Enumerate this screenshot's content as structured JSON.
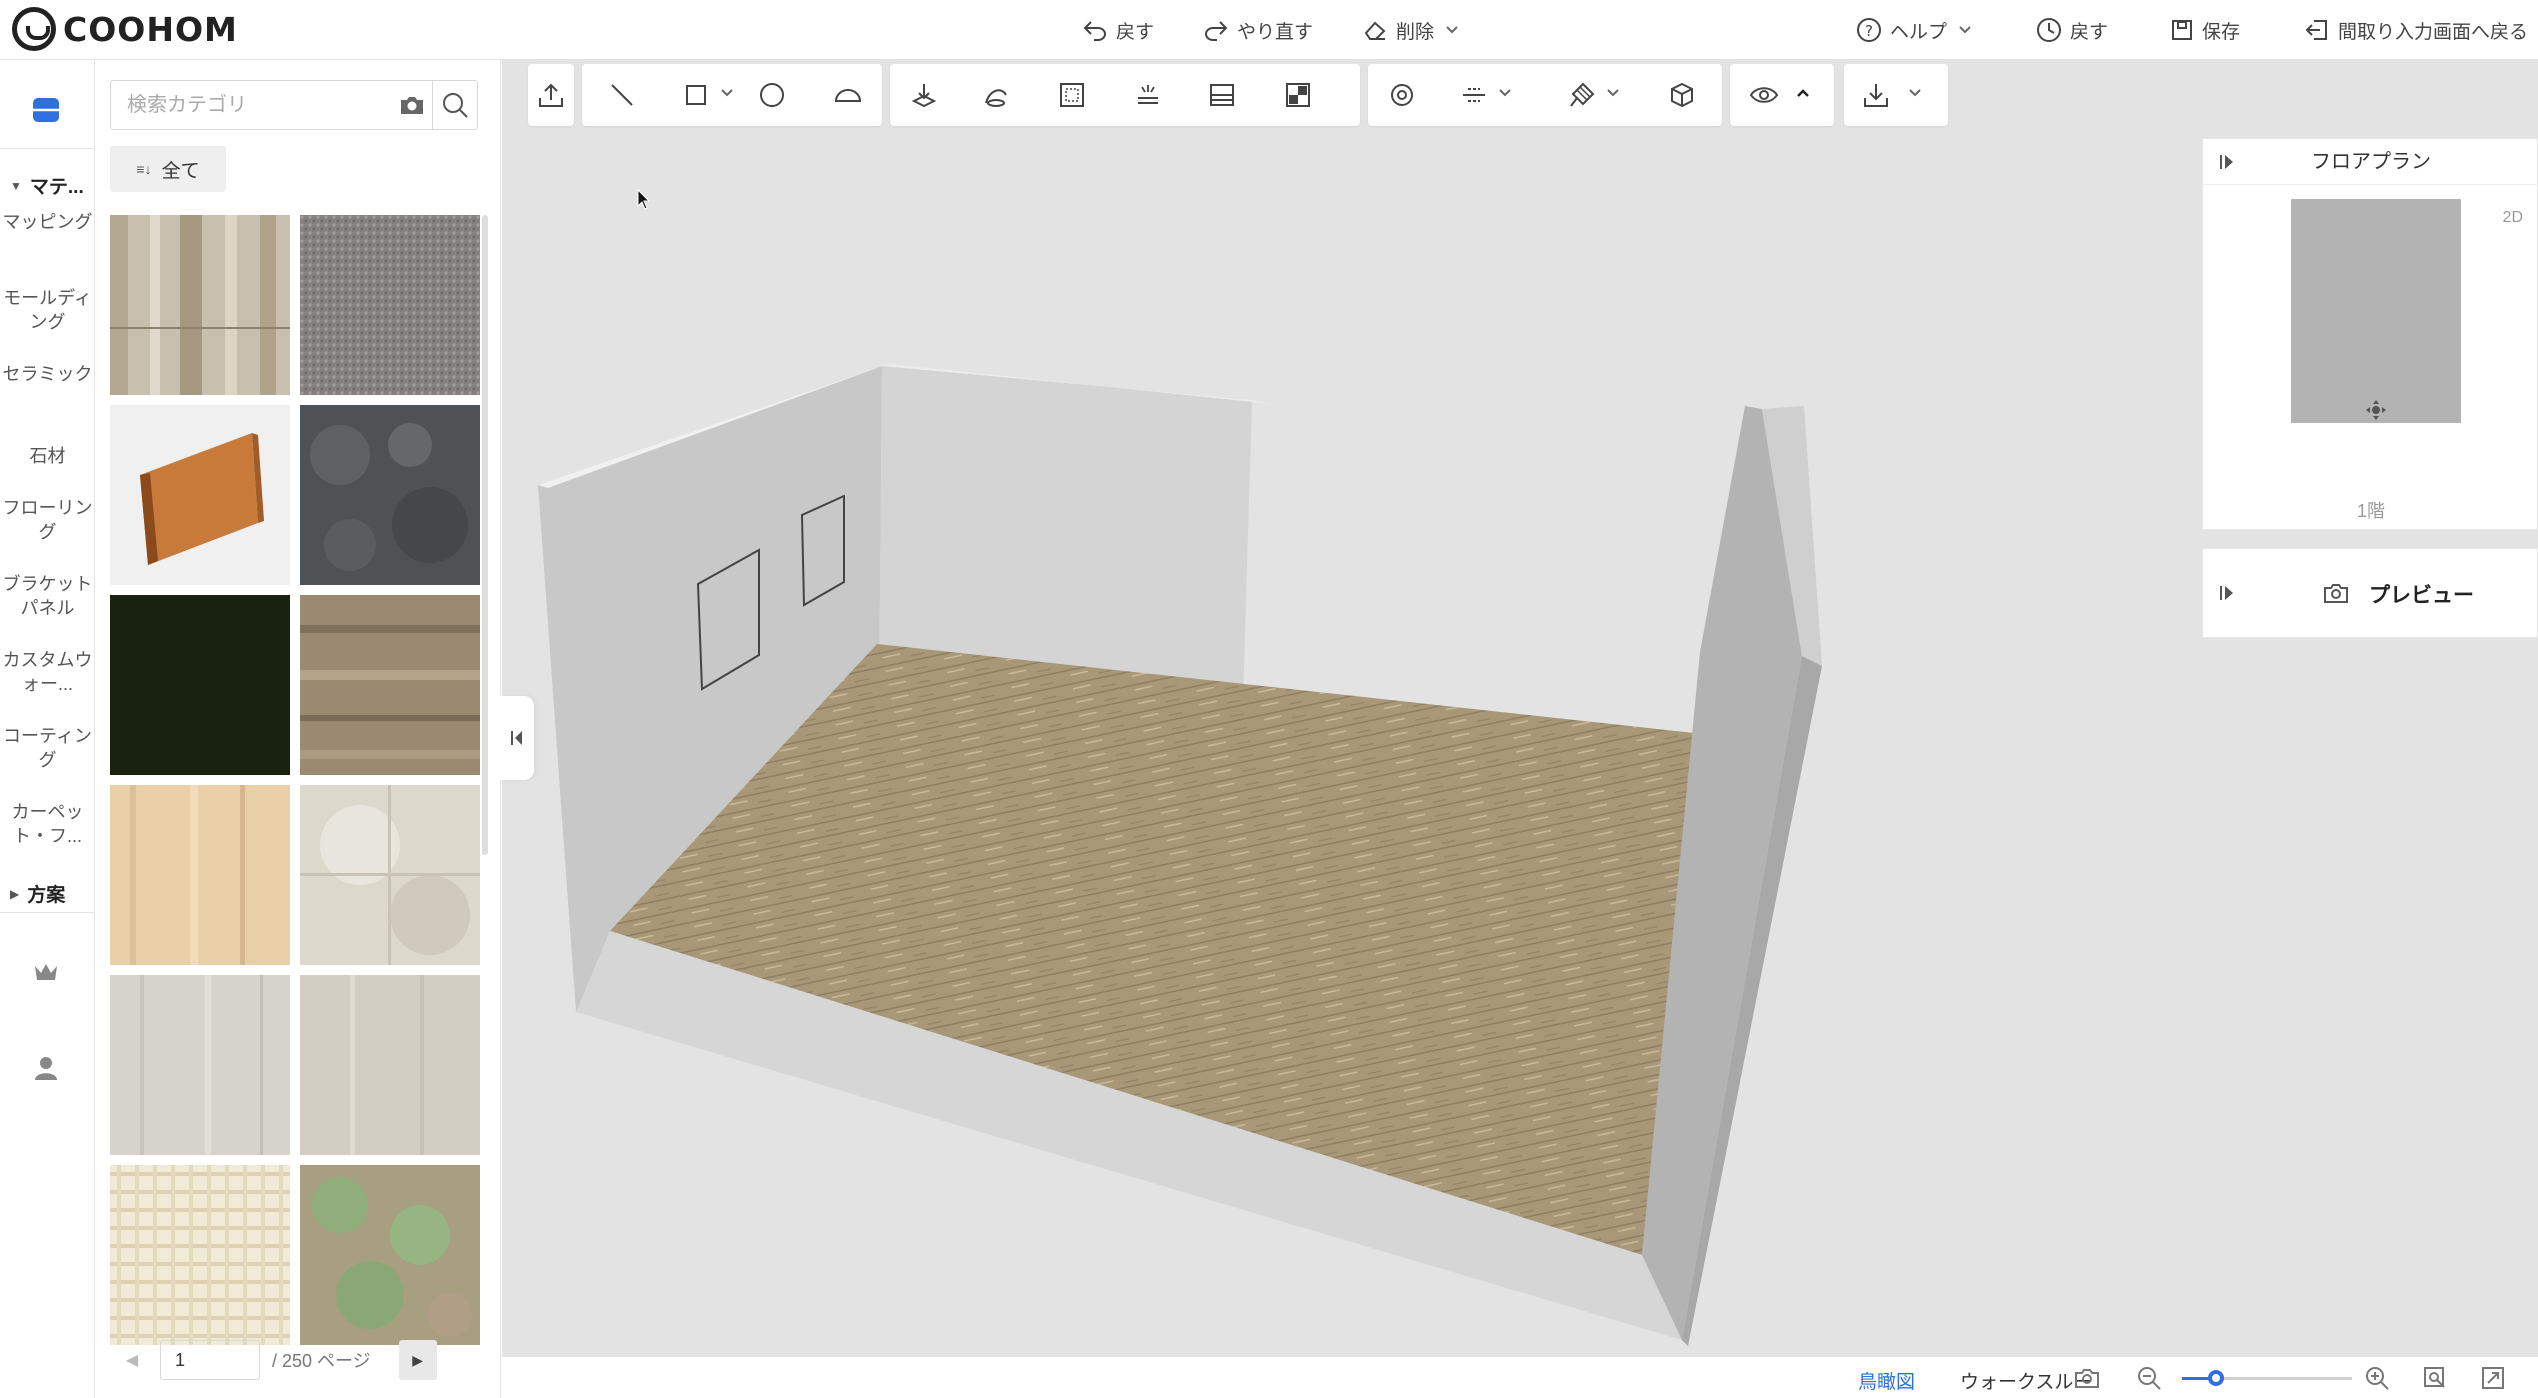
{
  "app": {
    "brand": "COOHOM"
  },
  "toolbar": {
    "undo": "戻す",
    "redo": "やり直す",
    "delete": "削除",
    "help": "ヘルプ",
    "history": "戻す",
    "save": "保存",
    "back_to_floorplan": "間取り入力画面へ戻る"
  },
  "rail": {
    "materials_header": "マテ...",
    "categories": [
      "マッピング",
      "モールディング",
      "セラミック",
      "石材",
      "フローリング",
      "ブラケットパネル",
      "カスタムウォー...",
      "コーティング",
      "カーペット・フ..."
    ],
    "plans_header": "方案"
  },
  "panel": {
    "search_placeholder": "検索カテゴリ",
    "filter_label": "全て",
    "page_current": "1",
    "page_total": "/ 250 ページ"
  },
  "floorplan": {
    "title": "フロアプラン",
    "mode_2d": "2D",
    "floor_label": "1階"
  },
  "preview": {
    "title": "プレビュー"
  },
  "bottombar": {
    "mode_birdseye": "鳥瞰図",
    "mode_walkthrough": "ウォークスルー",
    "zoom_percent": 20
  },
  "colors": {
    "accent": "#2f6fe0",
    "viewport_bg": "#e3e3e3",
    "floor_wood": "#a8977a"
  }
}
